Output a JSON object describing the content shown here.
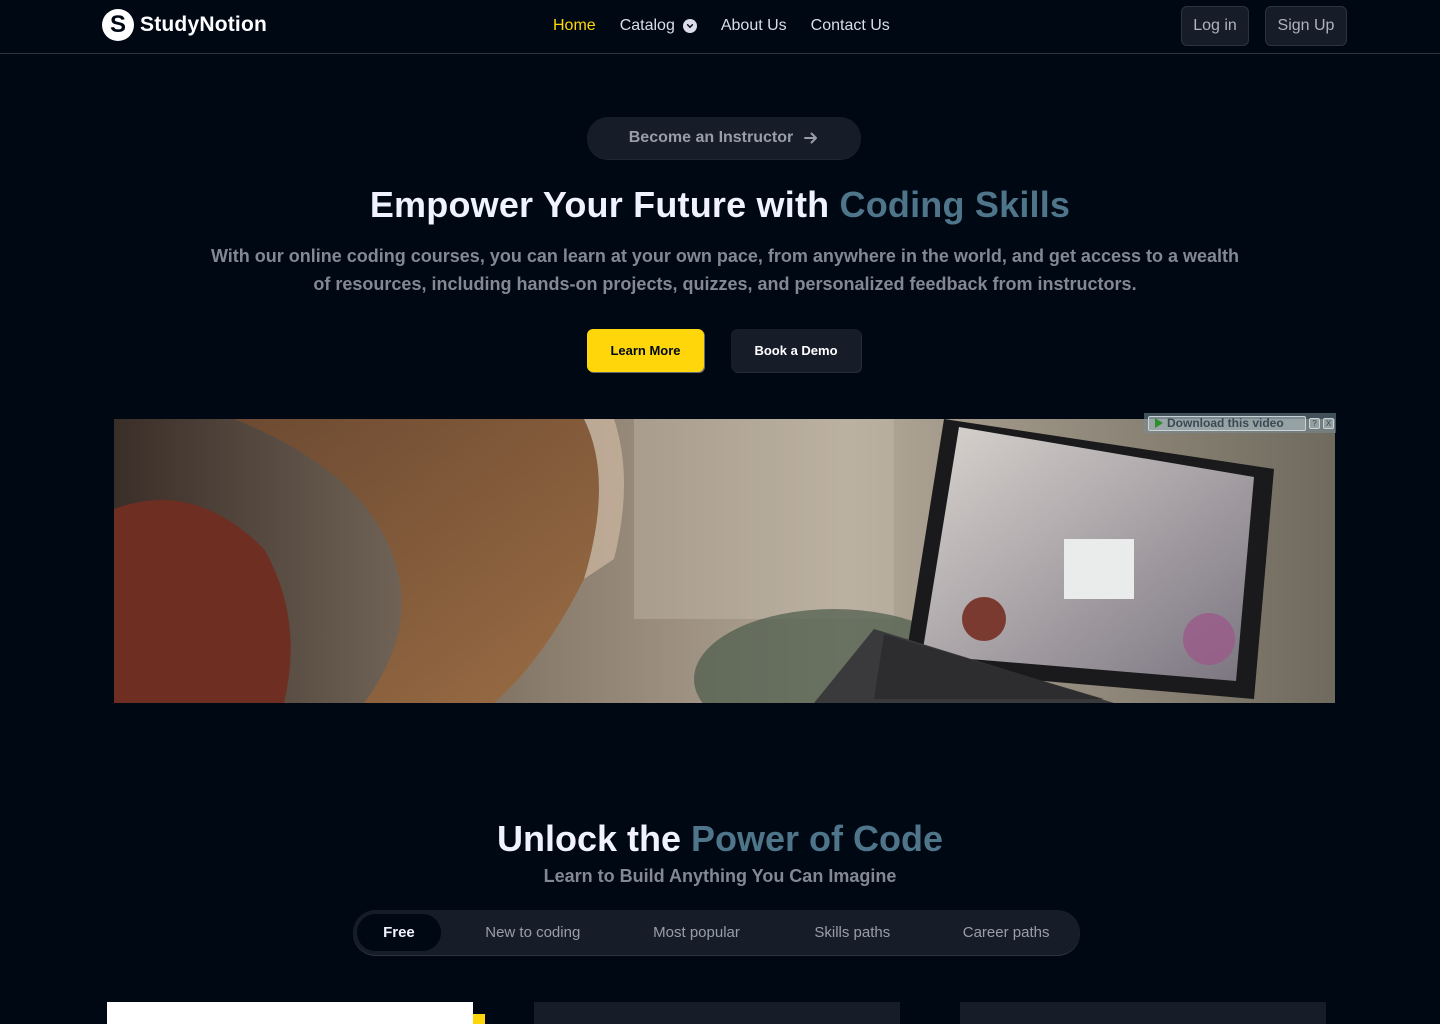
{
  "brand": {
    "logo_letter": "S",
    "name": "StudyNotion"
  },
  "nav": {
    "links": [
      {
        "label": "Home",
        "active": true
      },
      {
        "label": "Catalog",
        "has_dropdown": true
      },
      {
        "label": "About Us"
      },
      {
        "label": "Contact Us"
      }
    ],
    "login_label": "Log in",
    "signup_label": "Sign Up"
  },
  "hero": {
    "instructor_pill": "Become an Instructor",
    "title_prefix": "Empower Your Future with ",
    "title_highlight": "Coding Skills",
    "subtitle": "With our online coding courses, you can learn at your own pace, from anywhere in the world, and get access to a wealth of resources, including hands-on projects, quizzes, and personalized feedback from instructors.",
    "learn_more": "Learn More",
    "book_demo": "Book a Demo"
  },
  "video": {
    "download_label": "Download this video",
    "help_label": "?",
    "close_label": "X"
  },
  "section": {
    "title_prefix": "Unlock the ",
    "title_highlight": "Power of Code",
    "subtitle": "Learn to Build Anything You Can Imagine",
    "tabs": [
      "Free",
      "New to coding",
      "Most popular",
      "Skills paths",
      "Career paths"
    ],
    "active_tab": "Free"
  },
  "colors": {
    "background": "#000814",
    "accent_yellow": "#ffd60a",
    "highlight_blue": "#4e7589",
    "surface": "#161d29"
  }
}
